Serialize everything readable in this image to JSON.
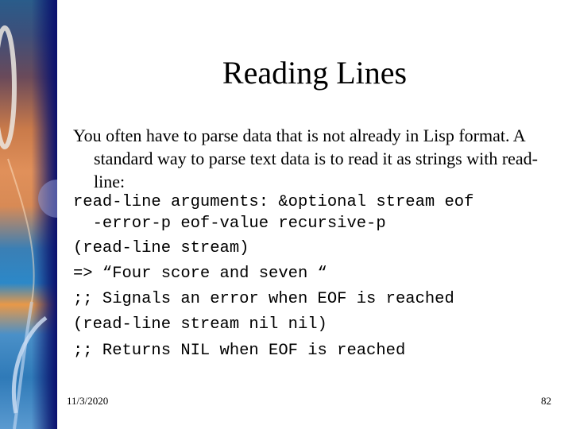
{
  "slide": {
    "title": "Reading Lines",
    "intro": "You often have to parse data that is not already in Lisp format. A standard way to parse text data is to read it as strings with read-line:",
    "code_lines": [
      "read-line arguments: &optional stream eof",
      "  -error-p eof-value recursive-p",
      "(read-line stream)",
      "=> “Four score and seven “",
      ";; Signals an error when EOF is reached",
      "(read-line stream nil nil)",
      ";; Returns NIL when EOF is reached"
    ]
  },
  "footer": {
    "date": "11/3/2020",
    "page_number": "82"
  },
  "theme": {
    "band_edge_color": "#0a0f6e",
    "text_color": "#000000",
    "background": "#ffffff"
  }
}
